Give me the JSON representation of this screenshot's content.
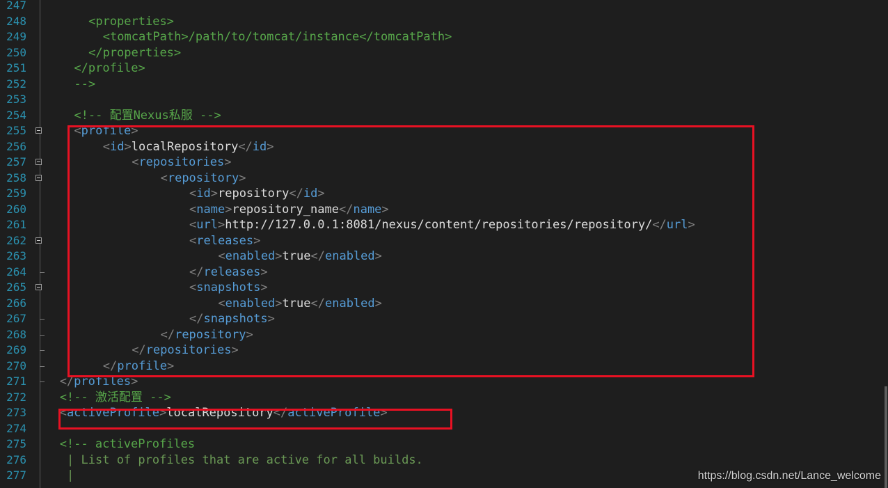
{
  "editor": {
    "lines": [
      {
        "n": "247",
        "indent": 0,
        "fold": "",
        "parts": []
      },
      {
        "n": "248",
        "indent": 6,
        "fold": "",
        "parts": [
          [
            "c",
            "<properties>"
          ]
        ]
      },
      {
        "n": "249",
        "indent": 8,
        "fold": "",
        "parts": [
          [
            "c",
            "<tomcatPath>/path/to/tomcat/instance</tomcatPath>"
          ]
        ]
      },
      {
        "n": "250",
        "indent": 6,
        "fold": "",
        "parts": [
          [
            "c",
            "</properties>"
          ]
        ]
      },
      {
        "n": "251",
        "indent": 4,
        "fold": "",
        "parts": [
          [
            "c",
            "</profile>"
          ]
        ]
      },
      {
        "n": "252",
        "indent": 4,
        "fold": "",
        "parts": [
          [
            "c",
            "-->"
          ]
        ]
      },
      {
        "n": "253",
        "indent": 0,
        "fold": "",
        "parts": []
      },
      {
        "n": "254",
        "indent": 4,
        "fold": "",
        "parts": [
          [
            "c",
            "<!-- 配置Nexus私服 -->"
          ]
        ]
      },
      {
        "n": "255",
        "indent": 4,
        "fold": "open",
        "parts": [
          [
            "b",
            "<"
          ],
          [
            "t",
            "profile"
          ],
          [
            "b",
            ">"
          ]
        ]
      },
      {
        "n": "256",
        "indent": 8,
        "fold": "",
        "parts": [
          [
            "b",
            "<"
          ],
          [
            "t",
            "id"
          ],
          [
            "b",
            ">"
          ],
          [
            "x",
            "localRepository"
          ],
          [
            "b",
            "</"
          ],
          [
            "t",
            "id"
          ],
          [
            "b",
            ">"
          ]
        ]
      },
      {
        "n": "257",
        "indent": 12,
        "fold": "open",
        "parts": [
          [
            "b",
            "<"
          ],
          [
            "t",
            "repositories"
          ],
          [
            "b",
            ">"
          ]
        ]
      },
      {
        "n": "258",
        "indent": 16,
        "fold": "open",
        "parts": [
          [
            "b",
            "<"
          ],
          [
            "t",
            "repository"
          ],
          [
            "b",
            ">"
          ]
        ]
      },
      {
        "n": "259",
        "indent": 20,
        "fold": "",
        "parts": [
          [
            "b",
            "<"
          ],
          [
            "t",
            "id"
          ],
          [
            "b",
            ">"
          ],
          [
            "x",
            "repository"
          ],
          [
            "b",
            "</"
          ],
          [
            "t",
            "id"
          ],
          [
            "b",
            ">"
          ]
        ]
      },
      {
        "n": "260",
        "indent": 20,
        "fold": "",
        "parts": [
          [
            "b",
            "<"
          ],
          [
            "t",
            "name"
          ],
          [
            "b",
            ">"
          ],
          [
            "x",
            "repository_name"
          ],
          [
            "b",
            "</"
          ],
          [
            "t",
            "name"
          ],
          [
            "b",
            ">"
          ]
        ]
      },
      {
        "n": "261",
        "indent": 20,
        "fold": "",
        "parts": [
          [
            "b",
            "<"
          ],
          [
            "t",
            "url"
          ],
          [
            "b",
            ">"
          ],
          [
            "x",
            "http://127.0.0.1:8081/nexus/content/repositories/repository/"
          ],
          [
            "b",
            "</"
          ],
          [
            "t",
            "url"
          ],
          [
            "b",
            ">"
          ]
        ]
      },
      {
        "n": "262",
        "indent": 20,
        "fold": "open",
        "parts": [
          [
            "b",
            "<"
          ],
          [
            "t",
            "releases"
          ],
          [
            "b",
            ">"
          ]
        ]
      },
      {
        "n": "263",
        "indent": 24,
        "fold": "",
        "parts": [
          [
            "b",
            "<"
          ],
          [
            "t",
            "enabled"
          ],
          [
            "b",
            ">"
          ],
          [
            "x",
            "true"
          ],
          [
            "b",
            "</"
          ],
          [
            "t",
            "enabled"
          ],
          [
            "b",
            ">"
          ]
        ]
      },
      {
        "n": "264",
        "indent": 20,
        "fold": "end",
        "parts": [
          [
            "b",
            "</"
          ],
          [
            "t",
            "releases"
          ],
          [
            "b",
            ">"
          ]
        ]
      },
      {
        "n": "265",
        "indent": 20,
        "fold": "open",
        "parts": [
          [
            "b",
            "<"
          ],
          [
            "t",
            "snapshots"
          ],
          [
            "b",
            ">"
          ]
        ]
      },
      {
        "n": "266",
        "indent": 24,
        "fold": "",
        "parts": [
          [
            "b",
            "<"
          ],
          [
            "t",
            "enabled"
          ],
          [
            "b",
            ">"
          ],
          [
            "x",
            "true"
          ],
          [
            "b",
            "</"
          ],
          [
            "t",
            "enabled"
          ],
          [
            "b",
            ">"
          ]
        ]
      },
      {
        "n": "267",
        "indent": 20,
        "fold": "end",
        "parts": [
          [
            "b",
            "</"
          ],
          [
            "t",
            "snapshots"
          ],
          [
            "b",
            ">"
          ]
        ]
      },
      {
        "n": "268",
        "indent": 16,
        "fold": "end",
        "parts": [
          [
            "b",
            "</"
          ],
          [
            "t",
            "repository"
          ],
          [
            "b",
            ">"
          ]
        ]
      },
      {
        "n": "269",
        "indent": 12,
        "fold": "end",
        "parts": [
          [
            "b",
            "</"
          ],
          [
            "t",
            "repositories"
          ],
          [
            "b",
            ">"
          ]
        ]
      },
      {
        "n": "270",
        "indent": 8,
        "fold": "end",
        "parts": [
          [
            "b",
            "</"
          ],
          [
            "t",
            "profile"
          ],
          [
            "b",
            ">"
          ]
        ]
      },
      {
        "n": "271",
        "indent": 2,
        "fold": "end",
        "parts": [
          [
            "b",
            "</"
          ],
          [
            "t",
            "profiles"
          ],
          [
            "b",
            ">"
          ]
        ]
      },
      {
        "n": "272",
        "indent": 2,
        "fold": "",
        "parts": [
          [
            "c",
            "<!-- 激活配置 -->"
          ]
        ]
      },
      {
        "n": "273",
        "indent": 2,
        "fold": "",
        "parts": [
          [
            "b",
            "<"
          ],
          [
            "t",
            "activeProfile"
          ],
          [
            "b",
            ">"
          ],
          [
            "x",
            "localRepository"
          ],
          [
            "b",
            "</"
          ],
          [
            "t",
            "activeProfile"
          ],
          [
            "b",
            ">"
          ]
        ]
      },
      {
        "n": "274",
        "indent": 0,
        "fold": "",
        "parts": []
      },
      {
        "n": "275",
        "indent": 2,
        "fold": "",
        "parts": [
          [
            "c",
            "<!-- activeProfiles"
          ]
        ]
      },
      {
        "n": "276",
        "indent": 3,
        "fold": "",
        "parts": [
          [
            "p",
            "| List of profiles that are active for all builds."
          ]
        ]
      },
      {
        "n": "277",
        "indent": 3,
        "fold": "",
        "parts": [
          [
            "p",
            "|"
          ]
        ]
      }
    ]
  },
  "watermark": "https://blog.csdn.net/Lance_welcome",
  "colors": {
    "background": "#1e1e1e",
    "line_number": "#2b91af",
    "tag_name": "#569cd6",
    "bracket": "#808080",
    "text": "#dcdcdc",
    "comment": "#57a64a",
    "highlight_border": "#e81123"
  }
}
